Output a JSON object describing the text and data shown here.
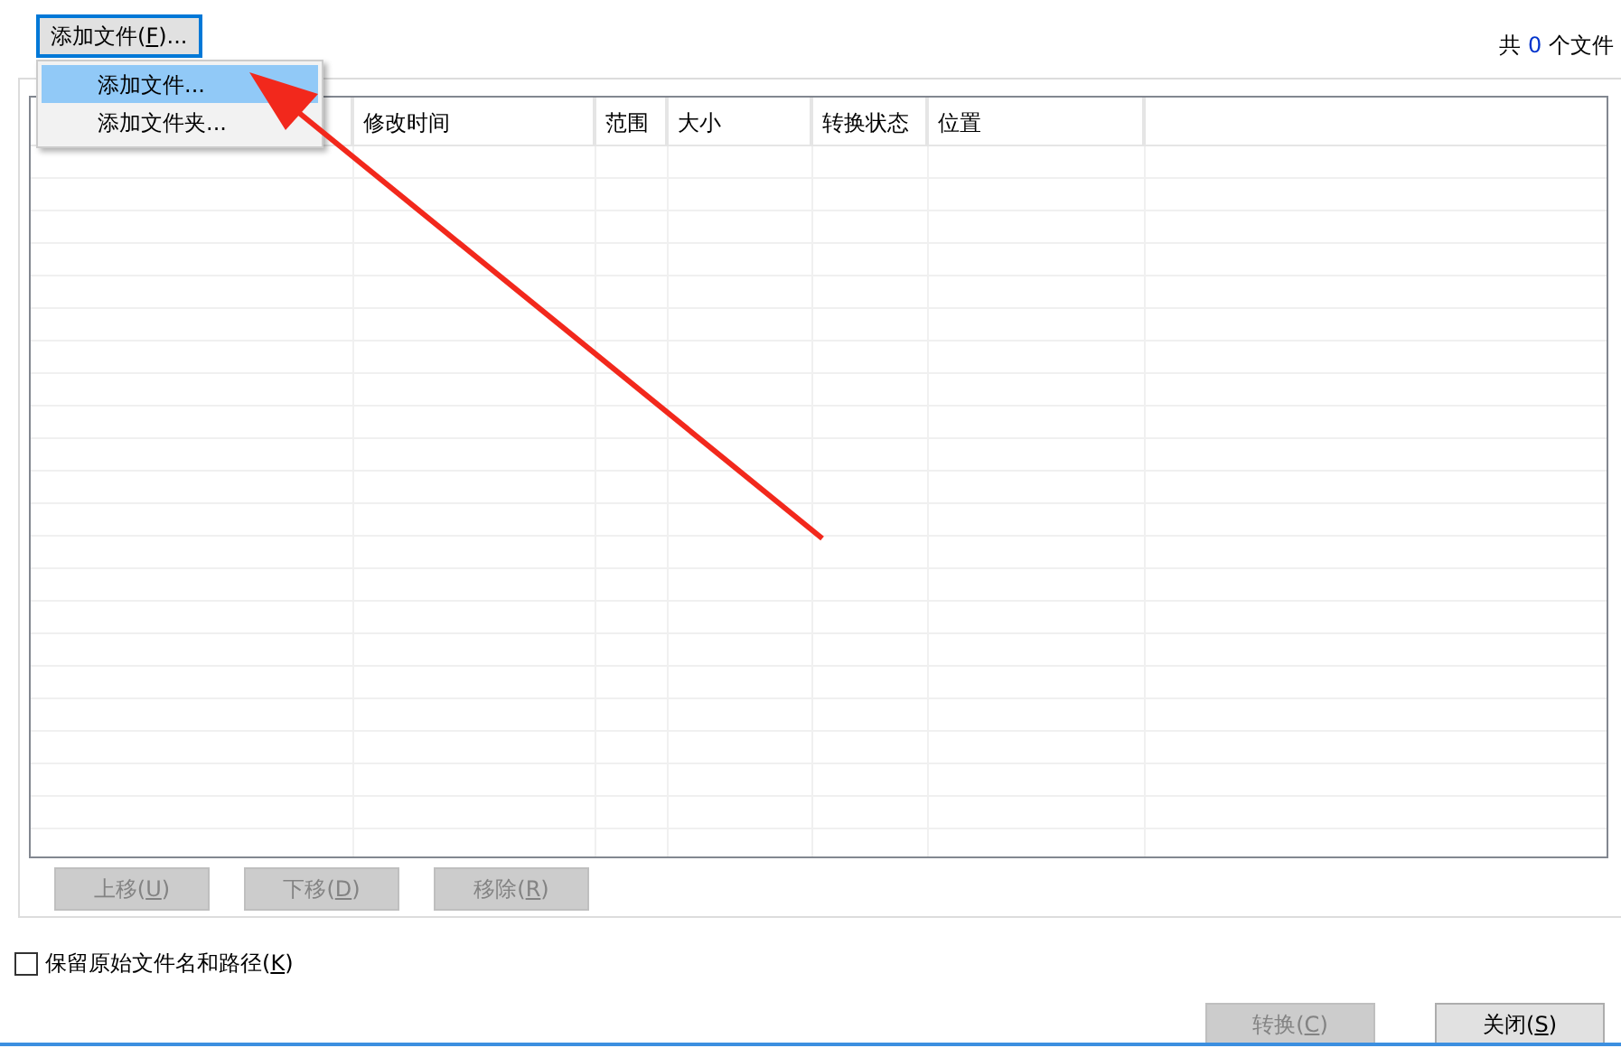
{
  "add_button": {
    "prefix": "添加文件(",
    "key": "F",
    "suffix": ")...",
    "focused": true
  },
  "file_count": {
    "prefix": "共",
    "number": "0",
    "suffix": "个文件"
  },
  "menu": {
    "items": [
      {
        "label": "添加文件...",
        "selected": true
      },
      {
        "label": "添加文件夹...",
        "selected": false
      }
    ]
  },
  "table": {
    "columns": [
      "",
      "修改时间",
      "范围",
      "大小",
      "转换状态",
      "位置",
      ""
    ]
  },
  "list_buttons": [
    {
      "prefix": "上移(",
      "key": "U",
      "suffix": ")",
      "disabled": true
    },
    {
      "prefix": "下移(",
      "key": "D",
      "suffix": ")",
      "disabled": true
    },
    {
      "prefix": "移除(",
      "key": "R",
      "suffix": ")",
      "disabled": true
    }
  ],
  "keep_path": {
    "prefix": "保留原始文件名和路径(",
    "key": "K",
    "suffix": ")",
    "checked": false
  },
  "footer_buttons": [
    {
      "prefix": "转换(",
      "key": "C",
      "suffix": ")",
      "disabled": true
    },
    {
      "prefix": "关闭(",
      "key": "S",
      "suffix": ")",
      "disabled": false
    }
  ]
}
